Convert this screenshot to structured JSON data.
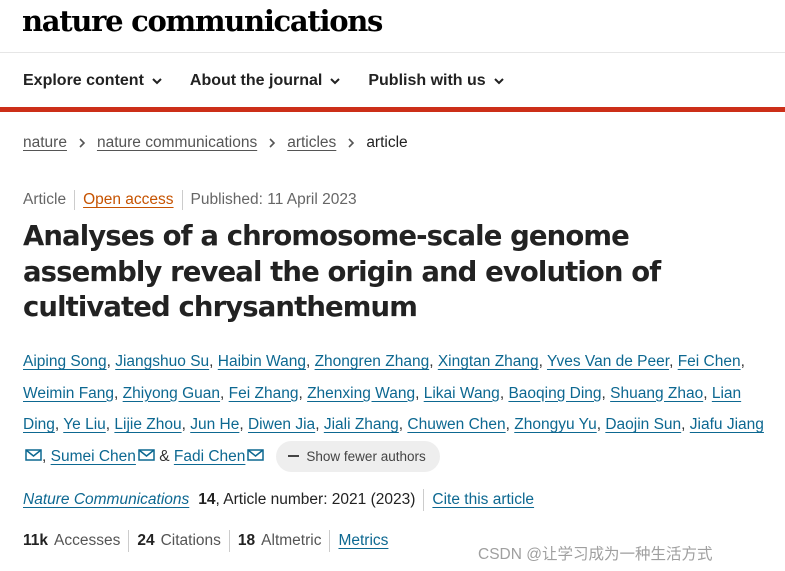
{
  "header": {
    "logo": "nature communications"
  },
  "nav": {
    "items": [
      {
        "label": "Explore content"
      },
      {
        "label": "About the journal"
      },
      {
        "label": "Publish with us"
      }
    ]
  },
  "breadcrumb": {
    "items": [
      "nature",
      "nature communications",
      "articles"
    ],
    "current": "article"
  },
  "article_meta": {
    "type": "Article",
    "access": "Open access",
    "published": "Published: 11 April 2023"
  },
  "title": "Analyses of a chromosome-scale genome assembly reveal the origin and evolution of cultivated chrysanthemum",
  "authors": {
    "list": [
      "Aiping Song",
      "Jiangshuo Su",
      "Haibin Wang",
      "Zhongren Zhang",
      "Xingtan Zhang",
      "Yves Van de Peer",
      "Fei Chen",
      "Weimin Fang",
      "Zhiyong Guan",
      "Fei Zhang",
      "Zhenxing Wang",
      "Likai Wang",
      "Baoqing Ding",
      "Shuang Zhao",
      "Lian Ding",
      "Ye Liu",
      "Lijie Zhou",
      "Jun He",
      "Diwen Jia",
      "Jiali Zhang",
      "Chuwen Chen",
      "Zhongyu Yu",
      "Daojin Sun",
      "Jiafu Jiang",
      "Sumei Chen",
      "Fadi Chen"
    ],
    "ampersand": "&",
    "toggle_label": "Show fewer authors"
  },
  "journal": {
    "name": "Nature Communications",
    "volume": "14",
    "article_number": ", Article number: 2021 (2023)",
    "cite_label": "Cite this article"
  },
  "metrics": {
    "accesses_value": "11k",
    "accesses_label": "Accesses",
    "citations_value": "24",
    "citations_label": "Citations",
    "altmetric_value": "18",
    "altmetric_label": "Altmetric",
    "metrics_link": "Metrics"
  },
  "watermark": "CSDN @让学习成为一种生活方式",
  "colors": {
    "accent_red": "#cc2f18",
    "link_blue": "#0d6891",
    "open_access_orange": "#c65301",
    "text": "#222222"
  },
  "icons": {
    "nav_dropdown": "chevron-down-icon",
    "breadcrumb_separator": "chevron-right-icon",
    "corresponding_author": "mail-icon",
    "collapse": "minus-icon"
  }
}
